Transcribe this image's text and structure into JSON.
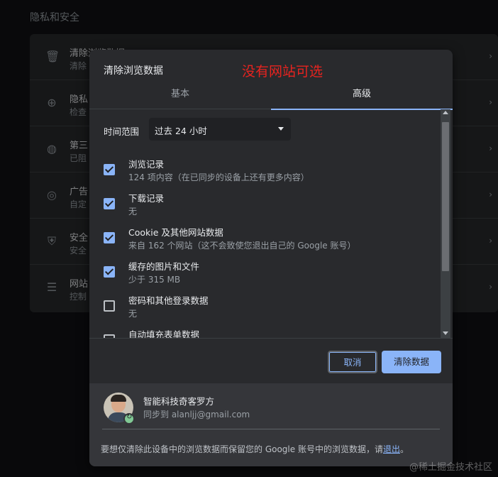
{
  "background": {
    "section_title": "隐私和安全",
    "rows": [
      {
        "icon": "trash-icon",
        "title": "清除浏览数据",
        "subtitle": "清除"
      },
      {
        "icon": "safety-check-icon",
        "title": "隐私",
        "subtitle": "检查"
      },
      {
        "icon": "cookie-icon",
        "title": "第三",
        "subtitle": "已阻"
      },
      {
        "icon": "ad-privacy-icon",
        "title": "广告",
        "subtitle": "自定"
      },
      {
        "icon": "shield-icon",
        "title": "安全",
        "subtitle": "安全"
      },
      {
        "icon": "sliders-icon",
        "title": "网站",
        "subtitle": "控制"
      }
    ]
  },
  "dialog": {
    "title": "清除浏览数据",
    "annotation": "没有网站可选",
    "tabs": [
      {
        "label": "基本",
        "selected": false
      },
      {
        "label": "高级",
        "selected": true
      }
    ],
    "time_range": {
      "label": "时间范围",
      "selected": "过去 24 小时"
    },
    "items": [
      {
        "title": "浏览记录",
        "subtitle": "124 项内容（在已同步的设备上还有更多内容）",
        "checked": true
      },
      {
        "title": "下载记录",
        "subtitle": "无",
        "checked": true
      },
      {
        "title": "Cookie 及其他网站数据",
        "subtitle": "来自 162 个网站（这不会致使您退出自己的 Google 账号）",
        "checked": true
      },
      {
        "title": "缓存的图片和文件",
        "subtitle": "少于 315 MB",
        "checked": true
      },
      {
        "title": "密码和其他登录数据",
        "subtitle": "无",
        "checked": false
      },
      {
        "title": "自动填充表单数据",
        "subtitle": "",
        "checked": false
      }
    ],
    "buttons": {
      "cancel": "取消",
      "clear": "清除数据"
    },
    "account": {
      "name": "智能科技奇客罗方",
      "sync": "同步到 alanljj@gmail.com"
    },
    "footer": {
      "text": "要想仅清除此设备中的浏览数据而保留您的 Google 账号中的浏览数据，请",
      "link": "退出",
      "suffix": "。"
    }
  },
  "watermark": "@稀土掘金技术社区",
  "colors": {
    "accent": "#8ab4f8",
    "annotation": "#e8231f",
    "dialog_bg": "#292a2d"
  }
}
